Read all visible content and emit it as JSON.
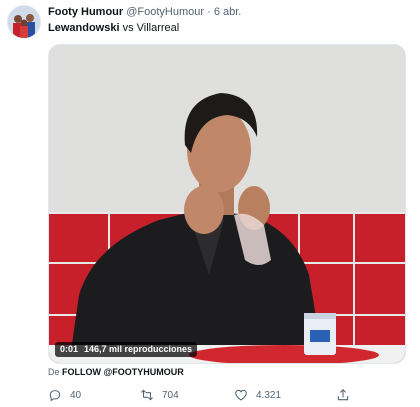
{
  "author": {
    "name": "Footy Humour",
    "handle": "@FootyHumour",
    "separator": "·",
    "time": "6 abr."
  },
  "tweet": {
    "text_bold": "Lewandowski",
    "text_rest": " vs Villarreal"
  },
  "video": {
    "duration": "0:01",
    "views": "146,7 mil reproducciones"
  },
  "source": {
    "prefix": "De",
    "account": "FOLLOW @FOOTYHUMOUR"
  },
  "actions": {
    "replies": "40",
    "retweets": "704",
    "likes": "4.321"
  },
  "icons": {
    "reply": "reply-icon",
    "retweet": "retweet-icon",
    "like": "heart-icon",
    "share": "share-icon"
  },
  "colors": {
    "text_primary": "#0f1419",
    "text_secondary": "#536471",
    "tile_red": "#c8202a"
  }
}
